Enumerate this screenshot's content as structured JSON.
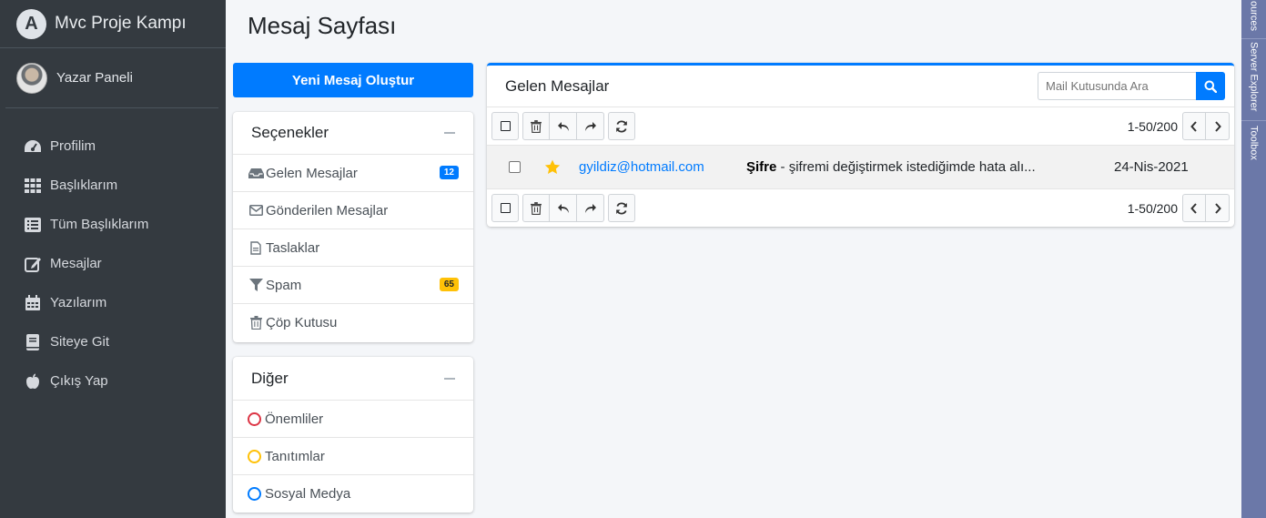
{
  "brand": {
    "name": "Mvc Proje Kampı",
    "logo_letter": "A"
  },
  "user": {
    "name": "Yazar Paneli"
  },
  "sidebar": {
    "items": [
      {
        "label": "Profilim",
        "icon": "tachometer-icon"
      },
      {
        "label": "Başlıklarım",
        "icon": "grid-icon"
      },
      {
        "label": "Tüm Başlıklarım",
        "icon": "list-icon"
      },
      {
        "label": "Mesajlar",
        "icon": "edit-icon"
      },
      {
        "label": "Yazılarım",
        "icon": "calendar-icon"
      },
      {
        "label": "Siteye Git",
        "icon": "book-icon"
      },
      {
        "label": "Çıkış Yap",
        "icon": "apple-icon"
      }
    ]
  },
  "page": {
    "title": "Mesaj Sayfası"
  },
  "compose": {
    "label": "Yeni Mesaj Oluştur"
  },
  "options": {
    "title": "Seçenekler",
    "items": [
      {
        "label": "Gelen Mesajlar",
        "icon": "inbox-icon",
        "badge": "12",
        "badge_color": "#007bff"
      },
      {
        "label": "Gönderilen Mesajlar",
        "icon": "envelope-icon"
      },
      {
        "label": "Taslaklar",
        "icon": "file-icon"
      },
      {
        "label": "Spam",
        "icon": "filter-icon",
        "badge": "65",
        "badge_color": "#ffc107"
      },
      {
        "label": "Çöp Kutusu",
        "icon": "trash-icon"
      }
    ]
  },
  "other": {
    "title": "Diğer",
    "items": [
      {
        "label": "Önemliler",
        "color": "#dc3545"
      },
      {
        "label": "Tanıtımlar",
        "color": "#ffc107"
      },
      {
        "label": "Sosyal Medya",
        "color": "#007bff"
      }
    ]
  },
  "inbox": {
    "title": "Gelen Mesajlar",
    "search_placeholder": "Mail Kutusunda Ara",
    "pager_text": "1-50/200",
    "messages": [
      {
        "from": "gyildiz@hotmail.com",
        "subject": "Şifre",
        "preview": " - şifremi değiştirmek istediğimde hata alı...",
        "date": "24-Nis-2021",
        "starred": true
      }
    ]
  },
  "vs_tabs": [
    "ources",
    "Server Explorer",
    "Toolbox"
  ]
}
